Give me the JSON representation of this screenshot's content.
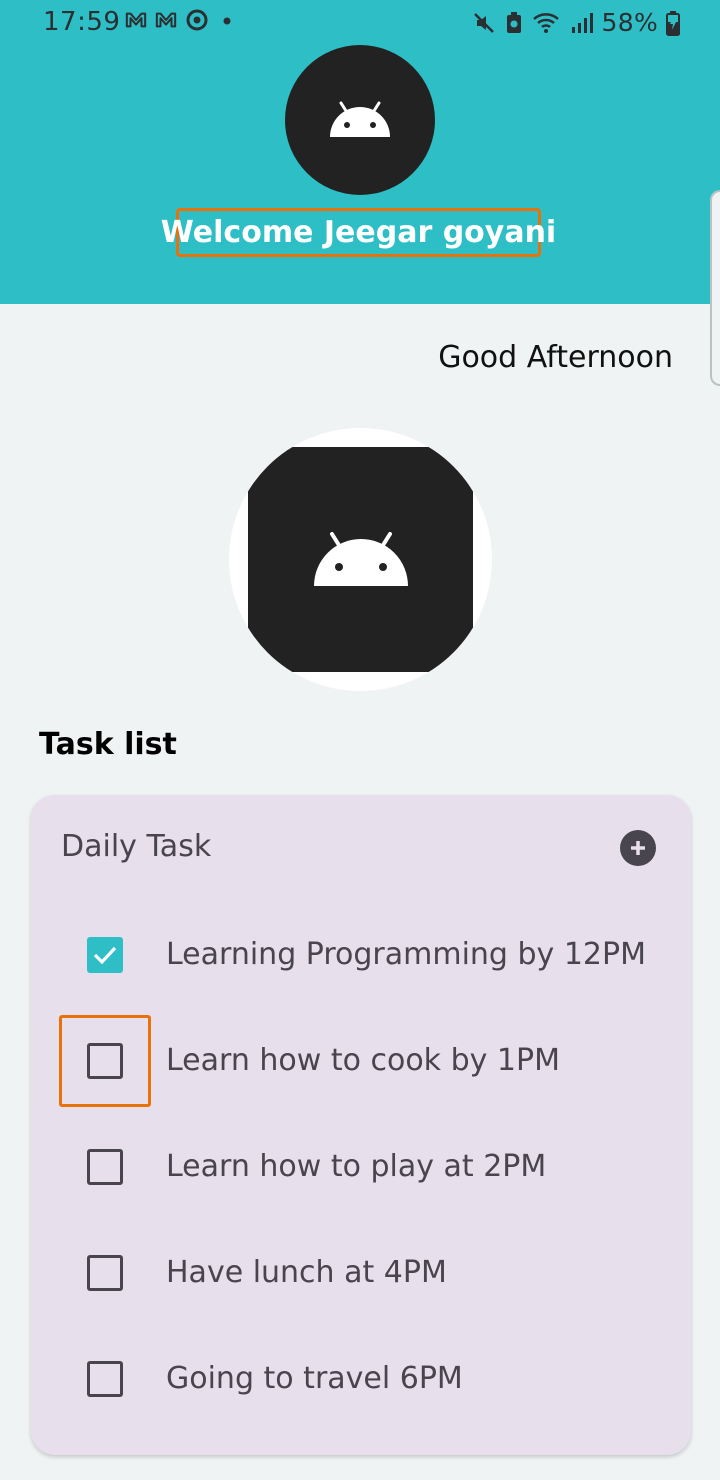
{
  "status_bar": {
    "time": "17:59",
    "battery": "58%"
  },
  "header": {
    "welcome_text": "Welcome Jeegar goyani",
    "avatar_icon": "android-icon"
  },
  "greeting": "Good Afternoon",
  "task_list": {
    "title": "Task list",
    "card_title": "Daily Task",
    "add_icon": "add-circle-icon",
    "tasks": [
      {
        "label": "Learning Programming by 12PM",
        "checked": true
      },
      {
        "label": "Learn how to cook by 1PM",
        "checked": false
      },
      {
        "label": "Learn how to play at 2PM",
        "checked": false
      },
      {
        "label": "Have lunch at 4PM",
        "checked": false
      },
      {
        "label": "Going to travel 6PM",
        "checked": false
      }
    ]
  },
  "colors": {
    "accent": "#2ebfc6",
    "card_background": "#e7dfec",
    "focus_outline": "#e8710a",
    "page_background": "#eff3f3"
  }
}
